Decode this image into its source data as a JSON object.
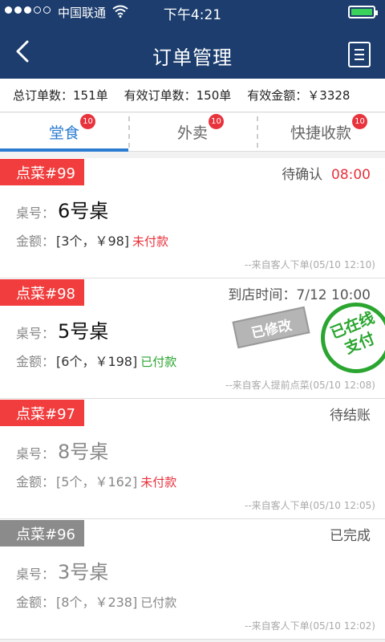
{
  "status_bar": {
    "carrier": "中国联通",
    "time": "下午4:21"
  },
  "nav": {
    "title": "订单管理"
  },
  "summary": {
    "total_orders": "总订单数：151单",
    "valid_orders": "有效订单数：150单",
    "valid_amount": "有效金额：￥3328"
  },
  "tabs": [
    {
      "label": "堂食",
      "badge": "10"
    },
    {
      "label": "外卖",
      "badge": "10"
    },
    {
      "label": "快捷收款",
      "badge": "10"
    }
  ],
  "table_label": "桌号：",
  "amount_label": "金额：",
  "orders": [
    {
      "tag": "点菜#99",
      "status": "待确认",
      "status_time": "08:00",
      "table": "6号桌",
      "amount": "[3个，￥98]",
      "payment": "未付款",
      "source": "--来自客人下单(05/10 12:10)"
    },
    {
      "tag": "点菜#98",
      "status": "到店时间：7/12 10:00",
      "table": "5号桌",
      "amount": "[6个，￥198]",
      "payment": "已付款",
      "source": "--来自客人提前点菜(05/10 12:08)",
      "stamp_modified": "已修改",
      "stamp_online_1": "已在线",
      "stamp_online_2": "支付"
    },
    {
      "tag": "点菜#97",
      "status": "待结账",
      "table": "8号桌",
      "amount": "[5个，￥162]",
      "payment": "未付款",
      "source": "--来自客人下单(05/10 12:05)"
    },
    {
      "tag": "点菜#96",
      "status": "已完成",
      "table": "3号桌",
      "amount": "[8个，￥238]",
      "payment": "已付款",
      "source": "--来自客人下单(05/10 12:02)"
    }
  ],
  "colors": {
    "header": "#1c3d6e",
    "accent_blue": "#2a7bd1",
    "red": "#f13d3d",
    "green": "#2aa52f",
    "gray_tag": "#8b8b8b"
  }
}
